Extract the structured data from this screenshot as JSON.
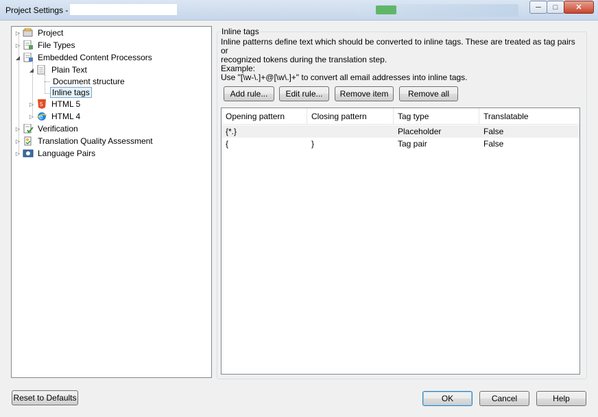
{
  "window": {
    "title": "Project Settings -",
    "controls": [
      "minimize",
      "maximize",
      "close"
    ]
  },
  "tree": {
    "items": [
      {
        "label": "Project",
        "icon": "project-icon"
      },
      {
        "label": "File Types",
        "icon": "file-types-icon"
      },
      {
        "label": "Embedded Content Processors",
        "icon": "processors-icon"
      },
      {
        "label": "Plain Text",
        "icon": "document-icon"
      },
      {
        "label": "Document structure",
        "icon": ""
      },
      {
        "label": "Inline tags",
        "icon": "",
        "selected": true
      },
      {
        "label": "HTML 5",
        "icon": "html5-icon"
      },
      {
        "label": "HTML 4",
        "icon": "ie-icon"
      },
      {
        "label": "Verification",
        "icon": "verification-icon"
      },
      {
        "label": "Translation Quality Assessment",
        "icon": "quality-icon"
      },
      {
        "label": "Language Pairs",
        "icon": "language-pairs-icon"
      }
    ]
  },
  "panel": {
    "group_title": "Inline tags",
    "description": {
      "line1": "Inline patterns define text which should be converted to inline tags. These are treated as tag pairs or",
      "line2": "recognized tokens during the translation step.",
      "line3": "Example:",
      "line4": "Use \"[\\w-\\.]+@[\\w\\.]+\" to convert all email addresses into inline tags."
    },
    "buttons": {
      "add": "Add rule...",
      "edit": "Edit rule...",
      "remove": "Remove item",
      "remove_all": "Remove all"
    },
    "table": {
      "columns": [
        "Opening pattern",
        "Closing pattern",
        "Tag type",
        "Translatable"
      ],
      "rows": [
        {
          "opening": "{*.}",
          "closing": "",
          "tag_type": "Placeholder",
          "translatable": "False"
        },
        {
          "opening": "{",
          "closing": "}",
          "tag_type": "Tag pair",
          "translatable": "False"
        }
      ]
    }
  },
  "footer": {
    "reset": "Reset to Defaults",
    "ok": "OK",
    "cancel": "Cancel",
    "help": "Help"
  }
}
